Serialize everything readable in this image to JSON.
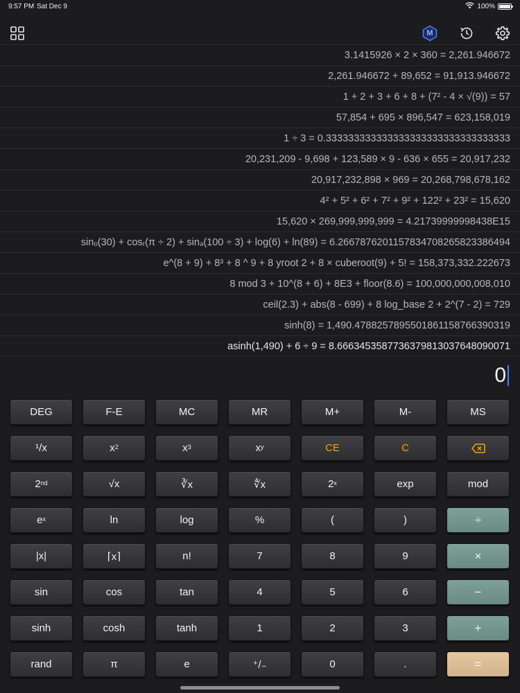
{
  "status": {
    "time": "9:57 PM",
    "date": "Sat Dec 9",
    "battery": "100%"
  },
  "toolbar": {
    "icons": [
      "grid-icon",
      "memory-icon",
      "history-icon",
      "gear-icon"
    ],
    "memory_label": "M",
    "accent": "#4d7fff"
  },
  "history": [
    "3.1415926 × 2 × 360 = 2,261.946672",
    "2,261.946672 + 89,652 = 91,913.946672",
    "1 + 2 + 3 + 6 + 8 + (7² - 4 × √(9)) = 57",
    "57,854 + 695 × 896,547 = 623,158,019",
    "1 ÷ 3 = 0.333333333333333333333333333333333",
    "20,231,209 - 9,698 + 123,589 × 9 - 636 × 655 = 20,917,232",
    "20,917,232,898 × 969 = 20,268,798,678,162",
    "4² + 5² + 6² + 7² + 9² + 122² + 23² = 15,620",
    "15,620 × 269,999,999,999 = 4.21739999998438E15",
    "sinₒ(30) + cosᵣ(π ÷ 2) + sinₔ(100 ÷ 3) + log(6) + ln(89) = 6.2667876201157834708265823386494",
    "e^(8 + 9) + 8³ + 8 ^ 9 + 8 yroot 2 + 8 × cuberoot(9) + 5! = 158,373,332.222673",
    "8 mod 3 + 10^(8 + 6) + 8E3 + floor(8.6) = 100,000,000,008,010",
    "ceil(2.3) + abs(8 - 699) + 8 log_base 2 + 2^(7 - 2) = 729",
    "sinh(8) = 1,490.4788257895501861158766390319",
    "asinh(1,490) + 6 ÷ 9 = 8.6663453587736379813037648090071"
  ],
  "display": {
    "value": "0"
  },
  "keys": {
    "deg": "DEG",
    "fe": "F-E",
    "mc": "MC",
    "mr": "MR",
    "mplus": "M+",
    "mminus": "M-",
    "ms": "MS",
    "reciprocal": "¹/x",
    "square": "x",
    "cube": "x",
    "power": "x",
    "ce": "CE",
    "c": "C",
    "backspace": "⌫",
    "second": "2",
    "sqrt": "√x",
    "cbrt": "∛x",
    "yroot": "∜x",
    "twopow": "2",
    "exp": "exp",
    "mod": "mod",
    "epow": "e",
    "ln": "ln",
    "log": "log",
    "percent": "%",
    "lparen": "(",
    "rparen": ")",
    "divide": "÷",
    "abs": "|x|",
    "floor": "⌈x⌉",
    "fact": "n!",
    "seven": "7",
    "eight": "8",
    "nine": "9",
    "multiply": "×",
    "sin": "sin",
    "cos": "cos",
    "tan": "tan",
    "four": "4",
    "five": "5",
    "six": "6",
    "minus": "−",
    "sinh": "sinh",
    "cosh": "cosh",
    "tanh": "tanh",
    "one": "1",
    "two": "2",
    "three": "3",
    "plus": "+",
    "rand": "rand",
    "pi": "π",
    "e": "e",
    "sign": "⁺/₋",
    "zero": "0",
    "dot": ".",
    "equals": "="
  },
  "superscripts": {
    "square": "2",
    "cube": "3",
    "power": "y",
    "second": "nd",
    "twopow": "x",
    "epow": "x"
  },
  "colors": {
    "orange": "#ff9f0a",
    "operator": "#7a9a94",
    "equals": "#d9bd96"
  }
}
